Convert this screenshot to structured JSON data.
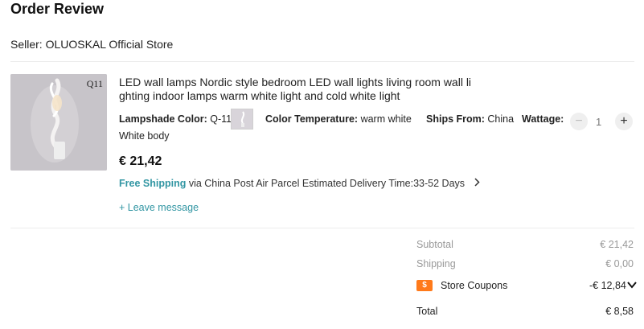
{
  "page": {
    "title": "Order Review"
  },
  "seller": {
    "label": "Seller: OLUOSKAL Official Store"
  },
  "product": {
    "image_badge": "Q11",
    "title_line1": "LED wall lamps Nordic style bedroom LED wall lights living room wall li",
    "title_line2": "ghting indoor lamps warm white light and cold white light",
    "attr_lampshade_key": "Lampshade Color:",
    "attr_lampshade_val": "Q-11",
    "attr_temp_key": "Color Temperature:",
    "attr_temp_val": "warm white",
    "attr_ships_key": "Ships From:",
    "attr_ships_val": "China",
    "attr_wattage_key": "Wattage:",
    "attr_body": "White body",
    "price": "€ 21,42",
    "quantity": "1"
  },
  "shipping": {
    "free_label": "Free Shipping",
    "via": "via China Post Air Parcel",
    "delivery": "Estimated Delivery Time:33-52 Days"
  },
  "message": {
    "label": "+ Leave message"
  },
  "summary": {
    "subtotal_label": "Subtotal",
    "subtotal_value": "€ 21,42",
    "shipping_label": "Shipping",
    "shipping_value": "€ 0,00",
    "coupon_label": "Store Coupons",
    "coupon_value": "-€ 12,84",
    "total_label": "Total",
    "total_value": "€ 8,58"
  },
  "colors": {
    "accent": "#3296a3",
    "coupon": "#ff7a1a"
  }
}
